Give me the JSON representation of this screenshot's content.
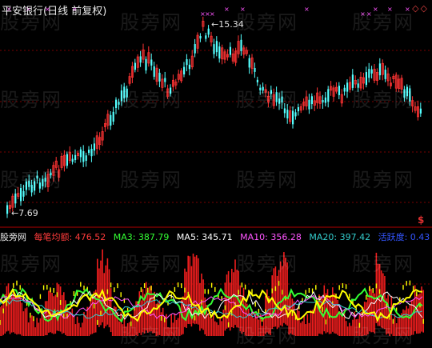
{
  "header": {
    "title": "平安银行(日线 前复权)",
    "corner_marks": "◇◇"
  },
  "price_panel": {
    "high_label": "15.34",
    "low_label": "7.69",
    "money_icon": "$"
  },
  "indicator_bar": {
    "name": "股旁网",
    "items": [
      {
        "label": "每笔均额: 476.52",
        "color": "#ff3b3b"
      },
      {
        "label": "MA3: 387.79",
        "color": "#33ff33"
      },
      {
        "label": "MA5: 345.71",
        "color": "#ffffff"
      },
      {
        "label": "MA10: 356.28",
        "color": "#ff55ff"
      },
      {
        "label": "MA20: 397.42",
        "color": "#33cccc"
      },
      {
        "label": "活跃度: 0.43",
        "color": "#3355ff"
      }
    ]
  },
  "watermarks": [
    "股旁网",
    "股旁网",
    "股旁网",
    "股旁网",
    "股旁网",
    "股旁网",
    "股旁网",
    "股旁网",
    "股旁网",
    "股旁网",
    "股旁网",
    "股旁网",
    "股旁网",
    "股旁网",
    "股旁网",
    "股旁网",
    "股旁网",
    "股旁网",
    "股旁网"
  ],
  "colors": {
    "up": "#ff3333",
    "down": "#54ffff",
    "grid": "#7a0000",
    "volume_bar": "#ff2020",
    "ma3": "#33ff33",
    "ma5": "#ffffff",
    "ma10": "#ff55ff",
    "ma20": "#33cccc",
    "yellow": "#ffff00",
    "marker": "#ff55ff"
  }
}
